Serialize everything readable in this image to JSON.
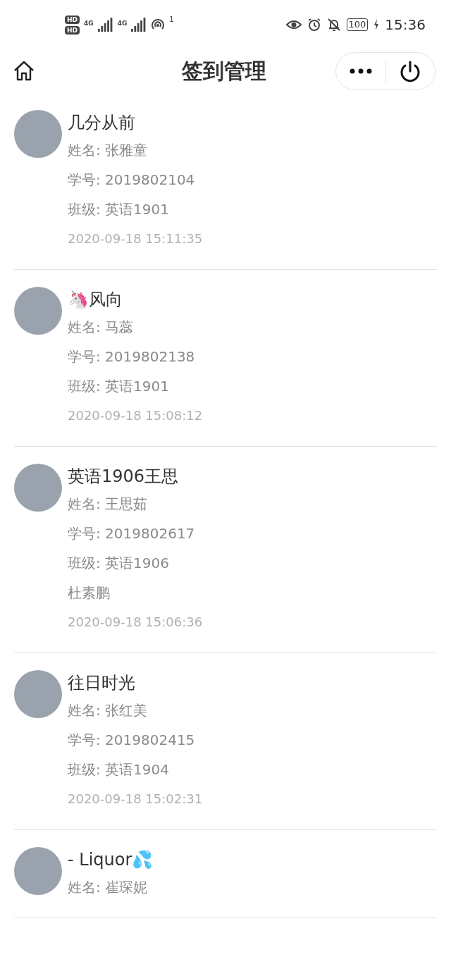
{
  "status_bar": {
    "sim_labels": [
      "HD",
      "HD"
    ],
    "network_labels": [
      "4G",
      "4G"
    ],
    "hotspot_count": "1",
    "battery": "100",
    "time": "15:36"
  },
  "header": {
    "title": "签到管理"
  },
  "entries": [
    {
      "nickname": "几分从前",
      "lines": [
        "姓名: 张雅童",
        "学号: 2019802104",
        "班级: 英语1901"
      ],
      "time": "2020-09-18 15:11:35"
    },
    {
      "nickname": "🦄风向",
      "lines": [
        "姓名: 马蕊",
        "学号: 2019802138",
        "班级: 英语1901"
      ],
      "time": "2020-09-18 15:08:12"
    },
    {
      "nickname": "英语1906王思",
      "lines": [
        "姓名: 王思茹",
        "学号: 2019802617",
        "班级: 英语1906",
        "杜素鹏"
      ],
      "time": "2020-09-18 15:06:36"
    },
    {
      "nickname": "往日时光",
      "lines": [
        "姓名: 张红美",
        "学号: 2019802415",
        "班级: 英语1904"
      ],
      "time": "2020-09-18 15:02:31"
    },
    {
      "nickname": "- Liquor💦",
      "lines": [
        "姓名: 崔琛妮"
      ]
    }
  ]
}
